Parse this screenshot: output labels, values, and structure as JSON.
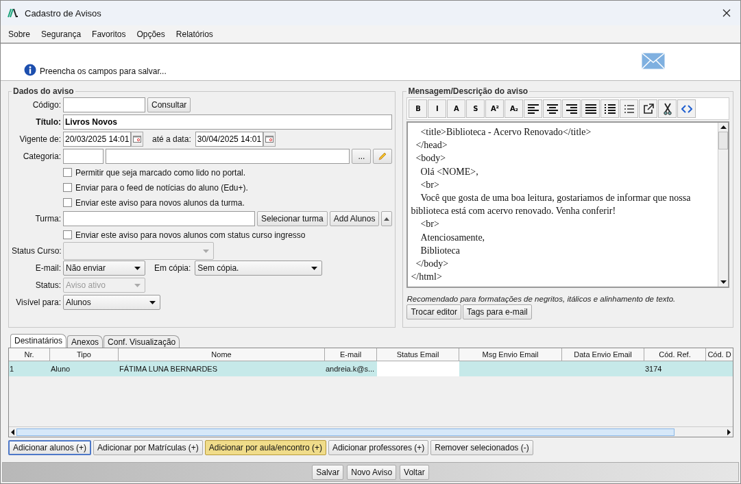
{
  "window": {
    "title": "Cadastro de Avisos"
  },
  "menu": [
    {
      "label": "Sobre"
    },
    {
      "label": "Segurança"
    },
    {
      "label": "Favoritos"
    },
    {
      "label": "Opções"
    },
    {
      "label": "Relatórios"
    }
  ],
  "info": {
    "message": "Preencha os campos para salvar..."
  },
  "form": {
    "legend": "Dados do aviso",
    "codigo": {
      "label": "Código:",
      "button": "Consultar"
    },
    "titulo": {
      "label": "Título:",
      "value": "Livros Novos"
    },
    "vigente": {
      "label": "Vigente de:",
      "value": "20/03/2025 14:01",
      "to_label": "até a data:",
      "to_value": "30/04/2025 14:01"
    },
    "categoria": {
      "label": "Categoria:",
      "button": "..."
    },
    "checks": [
      {
        "label": "Permitir que seja marcado como lido no portal.",
        "checked": false
      },
      {
        "label": "Enviar para o feed de notícias do aluno (Edu+).",
        "checked": false
      },
      {
        "label": "Enviar este aviso para novos alunos da turma.",
        "checked": false
      }
    ],
    "turma": {
      "label": "Turma:",
      "select_button": "Selecionar turma",
      "add_button": "Add Alunos"
    },
    "check_ingresso": {
      "label": "Enviar este aviso para novos alunos com status curso ingresso",
      "checked": false
    },
    "status_curso": {
      "label": "Status Curso:",
      "disabled": true
    },
    "email": {
      "label": "E-mail:",
      "value": "Não enviar",
      "disabled": false
    },
    "copia": {
      "label": "Em cópia:",
      "value": "Sem cópia.",
      "disabled": false
    },
    "status": {
      "label": "Status:",
      "value": "Aviso ativo",
      "disabled": true
    },
    "visivel": {
      "label": "Visível para:",
      "value": "Alunos",
      "disabled": false
    }
  },
  "message": {
    "legend": "Mensagem/Descrição do aviso",
    "toolbar": [
      {
        "kind": "text",
        "label": "B"
      },
      {
        "kind": "text",
        "label": "I"
      },
      {
        "kind": "text",
        "label": "A"
      },
      {
        "kind": "text",
        "label": "S"
      },
      {
        "kind": "text",
        "label": "A²"
      },
      {
        "kind": "text",
        "label": "A₂"
      },
      {
        "kind": "align-left"
      },
      {
        "kind": "align-center"
      },
      {
        "kind": "align-right"
      },
      {
        "kind": "justify"
      },
      {
        "kind": "bullets"
      },
      {
        "kind": "numbers"
      },
      {
        "kind": "external"
      },
      {
        "kind": "scissors"
      },
      {
        "kind": "code"
      }
    ],
    "lines": [
      "    <title>Biblioteca - Acervo Renovado</title>",
      "  </head>",
      "  <body>",
      "    Olá <NOME>,",
      "    <br>",
      "    Você que gosta de uma boa leitura, gostariamos de informar que nossa biblioteca está com acervo renovado. Venha conferir!",
      "    <br>",
      "    Atenciosamente,",
      "    Biblioteca",
      "  </body>",
      "</html>"
    ],
    "note": "Recomendado para formatações de negritos, itálicos e alinhamento de texto.",
    "buttons": [
      "Trocar editor",
      "Tags para e-mail"
    ]
  },
  "tabs": [
    {
      "label": "Destinatários",
      "selected": true
    },
    {
      "label": "Anexos",
      "selected": false
    },
    {
      "label": "Conf. Visualização",
      "selected": false
    }
  ],
  "table": {
    "columns": [
      "Nr.",
      "Tipo",
      "Nome",
      "E-mail",
      "Status Email",
      "Msg Envio Email",
      "Data Envio Email",
      "Cód. Ref.",
      "Cód. D"
    ],
    "rows": [
      {
        "selected": true,
        "cells": [
          "1",
          "Aluno",
          "FÁTIMA LUNA BERNARDES",
          "andreia.k@s...",
          "",
          "",
          "",
          "3174",
          ""
        ]
      }
    ]
  },
  "action_buttons": [
    {
      "label": "Adicionar alunos (+)",
      "focused": true,
      "hovered": false
    },
    {
      "label": "Adicionar por Matrículas (+)",
      "focused": false,
      "hovered": false
    },
    {
      "label": "Adicionar por aula/encontro (+)",
      "focused": false,
      "hovered": true
    },
    {
      "label": "Adicionar professores (+)",
      "focused": false,
      "hovered": false
    },
    {
      "label": "Remover selecionados (-)",
      "focused": false,
      "hovered": false
    }
  ],
  "footer_buttons": [
    "Salvar",
    "Novo Aviso",
    "Voltar"
  ]
}
